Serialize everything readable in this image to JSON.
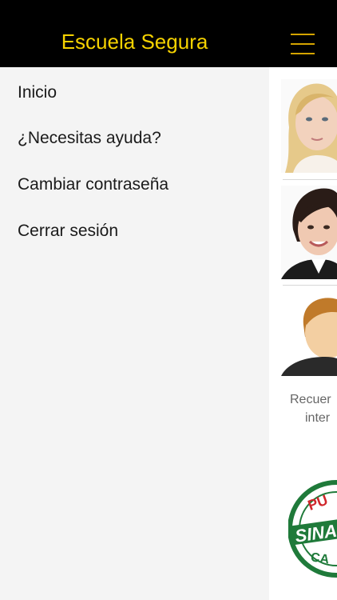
{
  "header": {
    "title": "Escuela Segura",
    "menu_icon": "hamburger-icon",
    "accent_color": "#F5D200"
  },
  "drawer": {
    "items": [
      {
        "label": "Inicio"
      },
      {
        "label": "¿Necesitas ayuda?"
      },
      {
        "label": "Cambiar contraseña"
      },
      {
        "label": "Cerrar sesión"
      }
    ]
  },
  "content": {
    "caption_line1": "Recuer",
    "caption_line2": "inter",
    "logo_text_top": "PU",
    "logo_text_middle": "SINA",
    "logo_text_bottom": "CA"
  }
}
